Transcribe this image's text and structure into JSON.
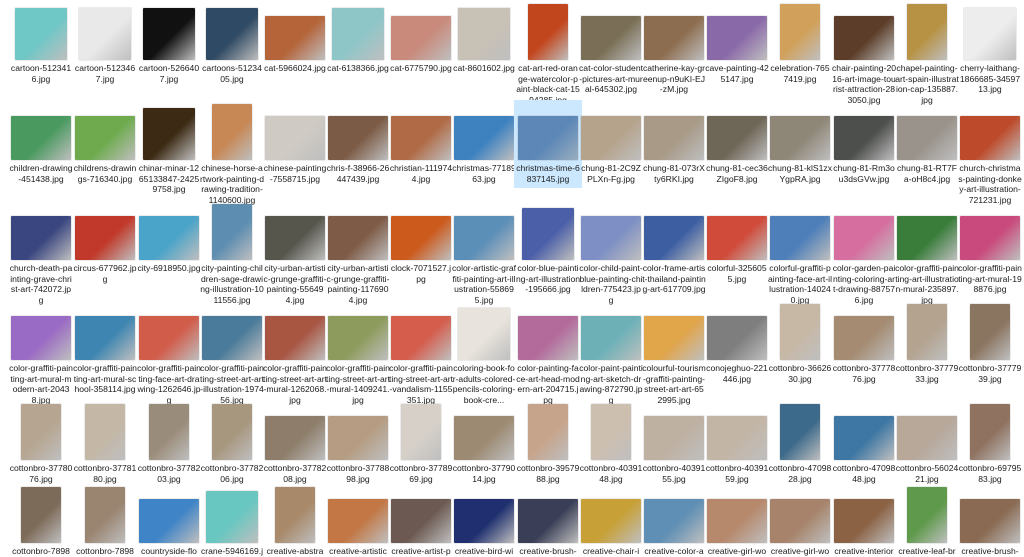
{
  "items": [
    {
      "caption": "cartoon-5123416.jpg",
      "color": "#6fc7c6",
      "shape": "square"
    },
    {
      "caption": "cartoon-5123467.jpg",
      "color": "#e9e9e9",
      "shape": "square"
    },
    {
      "caption": "cartoon-5266407.jpg",
      "color": "#111111",
      "shape": "square"
    },
    {
      "caption": "cartoons-5123405.jpg",
      "color": "#2f4a64",
      "shape": "square"
    },
    {
      "caption": "cat-5966024.jpg",
      "color": "#b5643a",
      "shape": "wide"
    },
    {
      "caption": "cat-6138366.jpg",
      "color": "#8ec6c8",
      "shape": "square"
    },
    {
      "caption": "cat-6775790.jpg",
      "color": "#c98a7c",
      "shape": "wide"
    },
    {
      "caption": "cat-8601602.jpg",
      "color": "#c8c1b5",
      "shape": "square"
    },
    {
      "caption": "cat-art-red-orange-watercolor-paint-black-cat-1594285.jpg",
      "color": "#c2461d",
      "shape": "tall"
    },
    {
      "caption": "cat-color-student-pictures-art-mural-645302.jpg",
      "color": "#7a6f56",
      "shape": "wide"
    },
    {
      "caption": "catherine-kay-greenup-n9uKI-EJ-zM.jpg",
      "color": "#8d6d4f",
      "shape": "wide"
    },
    {
      "caption": "cave-painting-425147.jpg",
      "color": "#8a69a9",
      "shape": "wide"
    },
    {
      "caption": "celebration-7657419.jpg",
      "color": "#d1a15b",
      "shape": "tall"
    },
    {
      "caption": "chair-painting-2016-art-image-tourist-attraction-283050.jpg",
      "color": "#5c3d29",
      "shape": "wide"
    },
    {
      "caption": "chapel-painting-art-spain-illustration-cap-135887.jpg",
      "color": "#b79244",
      "shape": "tall"
    },
    {
      "caption": "cherry-laithang-1866685-3459713.jpg",
      "color": "#ededee",
      "shape": "square"
    },
    {
      "caption": "children-drawing-451438.jpg",
      "color": "#4a9a60",
      "shape": "wide"
    },
    {
      "caption": "childrens-drawings-716340.jpg",
      "color": "#6fab4e",
      "shape": "wide"
    },
    {
      "caption": "chinar-minar-1265133847-24259758.jpg",
      "color": "#3c2a14",
      "shape": "square"
    },
    {
      "caption": "chinese-horse-artwork-painting-drawing-tradition-1140600.jpg",
      "color": "#c78855",
      "shape": "tall"
    },
    {
      "caption": "chinese-painting-7558715.jpg",
      "color": "#cfcac4",
      "shape": "wide"
    },
    {
      "caption": "chris-f-38966-26447439.jpg",
      "color": "#7b5b45",
      "shape": "wide"
    },
    {
      "caption": "christian-1119744.jpg",
      "color": "#b06a45",
      "shape": "wide"
    },
    {
      "caption": "christmas-7718963.jpg",
      "color": "#3e82c0",
      "shape": "wide"
    },
    {
      "caption": "christmas-time-6837145.jpg",
      "color": "#5d87b7",
      "shape": "wide",
      "selected": true
    },
    {
      "caption": "chung-81-2C9ZPLXn-Fg.jpg",
      "color": "#b5a38b",
      "shape": "wide"
    },
    {
      "caption": "chung-81-073rXty6RKI.jpg",
      "color": "#a89a87",
      "shape": "wide"
    },
    {
      "caption": "chung-81-cec36ZIgoF8.jpg",
      "color": "#6e6657",
      "shape": "wide"
    },
    {
      "caption": "chung-81-klS1zxYgpRA.jpg",
      "color": "#8e8677",
      "shape": "wide"
    },
    {
      "caption": "chung-81-Rm3ou3dsGVw.jpg",
      "color": "#4d4f4c",
      "shape": "wide"
    },
    {
      "caption": "chung-81-RT7Fa-oH8c4.jpg",
      "color": "#9a938b",
      "shape": "wide"
    },
    {
      "caption": "church-christmas-painting-donkey-art-illustration-721231.jpg",
      "color": "#bd4a2a",
      "shape": "wide"
    },
    {
      "caption": "church-death-painting-grave-christ-art-742072.jpg",
      "color": "#3a4680",
      "shape": "wide"
    },
    {
      "caption": "circus-677962.jpg",
      "color": "#c1392b",
      "shape": "wide"
    },
    {
      "caption": "city-6918950.jpg",
      "color": "#4aa3c9",
      "shape": "wide"
    },
    {
      "caption": "city-painting-children-sage-drawing-illustration-1011556.jpg",
      "color": "#5d8db1",
      "shape": "tall"
    },
    {
      "caption": "city-urban-artistic-grunge-graffiti-painting-556494.jpg",
      "color": "#57564d",
      "shape": "wide"
    },
    {
      "caption": "city-urban-artistic-grunge-graffiti-painting-1176904.jpg",
      "color": "#7e5b47",
      "shape": "wide"
    },
    {
      "caption": "clock-7071527.jpg",
      "color": "#cc5a1d",
      "shape": "wide"
    },
    {
      "caption": "color-artistic-graffiti-painting-art-illustration-558695.jpg",
      "color": "#5c8fb8",
      "shape": "wide"
    },
    {
      "caption": "color-blue-painting-art-illustration-195666.jpg",
      "color": "#4b5fa8",
      "shape": "square"
    },
    {
      "caption": "color-child-paint-blue-painting-children-775423.jpg",
      "color": "#7d8fc4",
      "shape": "wide"
    },
    {
      "caption": "color-frame-artist-thailand-painting-art-617709.jpg",
      "color": "#3d5fa2",
      "shape": "wide"
    },
    {
      "caption": "colorful-3256055.jpg",
      "color": "#d04b3a",
      "shape": "wide"
    },
    {
      "caption": "colorful-graffiti-painting-face-art-illustration-140240.jpg",
      "color": "#4e7fb8",
      "shape": "wide"
    },
    {
      "caption": "color-garden-painting-coloring-art-drawing-887576.jpg",
      "color": "#d66e9f",
      "shape": "wide"
    },
    {
      "caption": "color-graffiti-painting-art-illustration-mural-235897.jpg",
      "color": "#3a7d3b",
      "shape": "wide"
    },
    {
      "caption": "color-graffiti-painting-art-mural-198876.jpg",
      "color": "#c94a7c",
      "shape": "wide"
    },
    {
      "caption": "color-graffiti-painting-art-mural-modern-art-20438.jpg",
      "color": "#9a6bc4",
      "shape": "wide"
    },
    {
      "caption": "color-graffiti-painting-art-mural-school-358114.jpg",
      "color": "#3e86b1",
      "shape": "wide"
    },
    {
      "caption": "color-graffiti-painting-face-art-drawing-1262646.jpg",
      "color": "#d15c4a",
      "shape": "wide"
    },
    {
      "caption": "color-graffiti-painting-street-art-art-illustration-197456.jpg",
      "color": "#4b7b9a",
      "shape": "wide"
    },
    {
      "caption": "color-graffiti-painting-street-art-art-mural-1262068.jpg",
      "color": "#a85542",
      "shape": "wide"
    },
    {
      "caption": "color-graffiti-painting-street-art-art-mural-1409241.jpg",
      "color": "#8d9b5c",
      "shape": "wide"
    },
    {
      "caption": "color-graffiti-painting-street-art-art-vandalism-1155351.jpg",
      "color": "#d45d4c",
      "shape": "wide"
    },
    {
      "caption": "coloring-book-for-adults-colored-pencils-coloring-book-cre...",
      "color": "#e8e3dc",
      "shape": "square"
    },
    {
      "caption": "color-painting-face-art-head-modern-art-204715.jpg",
      "color": "#b36b9b",
      "shape": "wide"
    },
    {
      "caption": "color-paint-painting-art-sketch-drawing-872790.jpg",
      "color": "#6db1b7",
      "shape": "wide"
    },
    {
      "caption": "colourful-tourism-graffiti-painting-street-art-art-652995.jpg",
      "color": "#e1a54a",
      "shape": "wide"
    },
    {
      "caption": "conojeghuo-221446.jpg",
      "color": "#7e7e7e",
      "shape": "wide"
    },
    {
      "caption": "cottonbro-3662630.jpg",
      "color": "#c7b8a6",
      "shape": "tall"
    },
    {
      "caption": "cottonbro-3777876.jpg",
      "color": "#a48b72",
      "shape": "wide"
    },
    {
      "caption": "cottonbro-3777933.jpg",
      "color": "#b3a38f",
      "shape": "tall"
    },
    {
      "caption": "cottonbro-3777939.jpg",
      "color": "#8a7560",
      "shape": "tall"
    },
    {
      "caption": "cottonbro-3778076.jpg",
      "color": "#b6a691",
      "shape": "tall"
    },
    {
      "caption": "cottonbro-3778180.jpg",
      "color": "#c4b7a5",
      "shape": "tall"
    },
    {
      "caption": "cottonbro-3778203.jpg",
      "color": "#9a8c7a",
      "shape": "tall"
    },
    {
      "caption": "cottonbro-3778206.jpg",
      "color": "#a8977f",
      "shape": "tall"
    },
    {
      "caption": "cottonbro-3778208.jpg",
      "color": "#8d7d6a",
      "shape": "wide"
    },
    {
      "caption": "cottonbro-3778898.jpg",
      "color": "#b59c82",
      "shape": "wide"
    },
    {
      "caption": "cottonbro-3778969.jpg",
      "color": "#d6d0c8",
      "shape": "tall"
    },
    {
      "caption": "cottonbro-3779014.jpg",
      "color": "#9c8a72",
      "shape": "wide"
    },
    {
      "caption": "cottonbro-3957988.jpg",
      "color": "#c6a48c",
      "shape": "tall"
    },
    {
      "caption": "cottonbro-4039148.jpg",
      "color": "#cdbfb0",
      "shape": "tall"
    },
    {
      "caption": "cottonbro-4039155.jpg",
      "color": "#bfb1a2",
      "shape": "wide"
    },
    {
      "caption": "cottonbro-4039159.jpg",
      "color": "#c3b5a6",
      "shape": "wide"
    },
    {
      "caption": "cottonbro-4709828.jpg",
      "color": "#3c6a8a",
      "shape": "tall"
    },
    {
      "caption": "cottonbro-4709848.jpg",
      "color": "#3e77a3",
      "shape": "wide"
    },
    {
      "caption": "cottonbro-5602421.jpg",
      "color": "#b7a89a",
      "shape": "wide"
    },
    {
      "caption": "cottonbro-6979583.jpg",
      "color": "#8f7260",
      "shape": "tall"
    },
    {
      "caption": "cottonbro-7898",
      "color": "#7d6b59",
      "shape": "tall"
    },
    {
      "caption": "cottonbro-7898",
      "color": "#9a8571",
      "shape": "tall"
    },
    {
      "caption": "countryside-flo",
      "color": "#3f84c6",
      "shape": "wide"
    },
    {
      "caption": "crane-5946169.j",
      "color": "#69c7c1",
      "shape": "square"
    },
    {
      "caption": "creative-abstra",
      "color": "#a88a6b",
      "shape": "tall"
    },
    {
      "caption": "creative-artistic",
      "color": "#c27744",
      "shape": "wide"
    },
    {
      "caption": "creative-artist-p",
      "color": "#6c5a52",
      "shape": "wide"
    },
    {
      "caption": "creative-bird-wi",
      "color": "#1f2f6f",
      "shape": "wide"
    },
    {
      "caption": "creative-brush-",
      "color": "#3a3f57",
      "shape": "wide"
    },
    {
      "caption": "creative-chair-i",
      "color": "#c7a038",
      "shape": "wide"
    },
    {
      "caption": "creative-color-a",
      "color": "#5f8fb4",
      "shape": "wide"
    },
    {
      "caption": "creative-girl-wo",
      "color": "#b6896d",
      "shape": "wide"
    },
    {
      "caption": "creative-girl-wo",
      "color": "#a6836a",
      "shape": "wide"
    },
    {
      "caption": "creative-interior",
      "color": "#8b6244",
      "shape": "wide"
    },
    {
      "caption": "creative-leaf-br",
      "color": "#5f9a4c",
      "shape": "tall"
    },
    {
      "caption": "creative-brush-",
      "color": "#8a6a52",
      "shape": "wide"
    }
  ]
}
